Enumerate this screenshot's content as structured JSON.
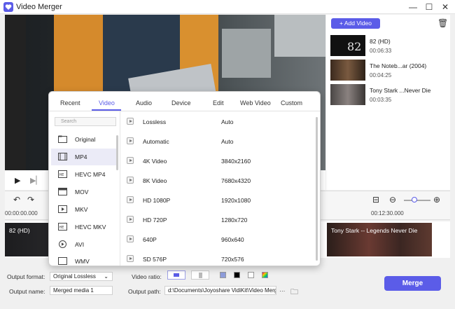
{
  "app": {
    "title": "Video Merger"
  },
  "window": {
    "minimize": "—",
    "maximize": "☐",
    "close": "✕"
  },
  "toolbar": {
    "zoom_out": "⊖",
    "zoom_in": "⊕",
    "fit": "⊟",
    "zoom_level": 0.35
  },
  "ruler": {
    "start": "00:00:00.000",
    "end": "00:12:30.000"
  },
  "playlist": {
    "add_label": "+ Add Video",
    "items": [
      {
        "title": "82 (HD)",
        "duration": "00:06:33"
      },
      {
        "title": "The Noteb...ar (2004)",
        "duration": "00:04:25"
      },
      {
        "title": "Tony Stark ...Never Die",
        "duration": "00:03:35"
      }
    ]
  },
  "timeline": {
    "clips": [
      {
        "label": "82 (HD)"
      },
      {
        "label": "Tony Stark -- Legends Never Die"
      }
    ]
  },
  "format_popup": {
    "tabs": [
      "Recent",
      "Video",
      "Audio",
      "Device",
      "Edit",
      "Web Video",
      "Custom"
    ],
    "active_tab": "Video",
    "search_placeholder": "Search",
    "formats": [
      "Original",
      "MP4",
      "HEVC MP4",
      "MOV",
      "MKV",
      "HEVC MKV",
      "AVI",
      "WMV"
    ],
    "selected_format": "MP4",
    "presets": [
      {
        "name": "Lossless",
        "resolution": "Auto"
      },
      {
        "name": "Automatic",
        "resolution": "Auto"
      },
      {
        "name": "4K Video",
        "resolution": "3840x2160"
      },
      {
        "name": "8K Video",
        "resolution": "7680x4320"
      },
      {
        "name": "HD 1080P",
        "resolution": "1920x1080"
      },
      {
        "name": "HD 720P",
        "resolution": "1280x720"
      },
      {
        "name": "640P",
        "resolution": "960x640"
      },
      {
        "name": "SD 576P",
        "resolution": "720x576"
      }
    ]
  },
  "bottom": {
    "output_format_label": "Output format:",
    "output_format_value": "Original Lossless",
    "output_name_label": "Output name:",
    "output_name_value": "Merged media 1",
    "video_ratio_label": "Video ratio:",
    "output_path_label": "Output path:",
    "output_path_value": "d:\\Documents\\Joyoshare VidiKit\\Video Merg",
    "path_more": "···",
    "merge_label": "Merge"
  },
  "colors": {
    "accent": "#5b5ce8"
  }
}
